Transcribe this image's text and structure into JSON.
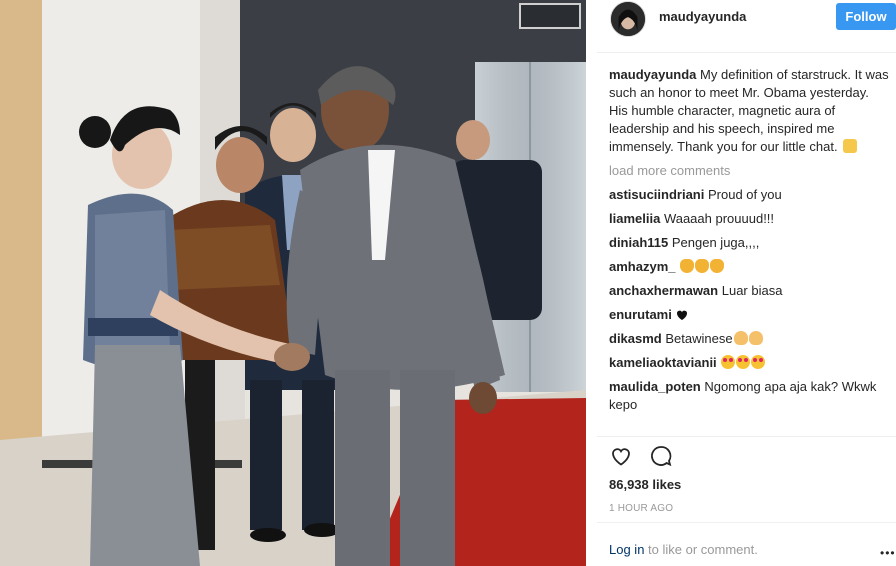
{
  "post": {
    "image_alt": "",
    "header": {
      "username": "maudyayunda",
      "follow_label": "Follow"
    },
    "caption": {
      "username": "maudyayunda",
      "text": "My definition of starstruck. It was such an honor to meet Mr. Obama yesterday. His humble character, magnetic aura of leadership and his speech, inspired me immensely. Thank you for our little chat."
    },
    "load_more_label": "load more comments",
    "comments": [
      {
        "username": "astisuciindriani",
        "text": "Proud of you",
        "emojis": []
      },
      {
        "username": "liameliia",
        "text": "Waaaah prouuud!!!",
        "emojis": []
      },
      {
        "username": "diniah115",
        "text": "Pengen juga,,,,",
        "emojis": []
      },
      {
        "username": "amhazym_",
        "text": "",
        "emojis": [
          "clap",
          "clap",
          "clap"
        ]
      },
      {
        "username": "anchaxhermawan",
        "text": "Luar biasa",
        "emojis": []
      },
      {
        "username": "enurutami",
        "text": "",
        "emojis": [
          "black-heart"
        ]
      },
      {
        "username": "dikasmd",
        "text": "Betawinese",
        "emojis": [
          "ok",
          "ok"
        ]
      },
      {
        "username": "kameliaoktavianii",
        "text": "",
        "emojis": [
          "heart-eyes",
          "heart-eyes",
          "heart-eyes"
        ]
      },
      {
        "username": "maulida_poten",
        "text": "Ngomong apa aja kak? Wkwk kepo",
        "emojis": []
      }
    ],
    "actions": {
      "like_icon": "heart-outline-icon",
      "comment_icon": "comment-bubble-icon"
    },
    "likes_text": "86,938 likes",
    "timestamp": "1 HOUR AGO",
    "footer": {
      "login_label": "Log in",
      "login_suffix": "to like or comment.",
      "more_label": "•••"
    }
  },
  "colors": {
    "follow_button": "#3897f0",
    "muted_text": "#999999",
    "primary_text": "#262626",
    "link_text": "#003569",
    "divider": "#efefef"
  }
}
